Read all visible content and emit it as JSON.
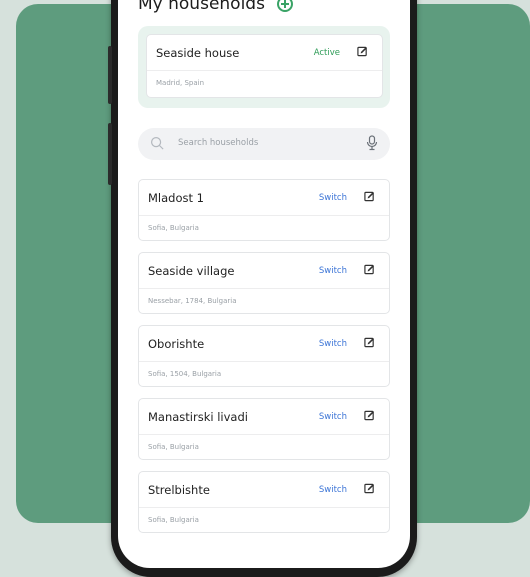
{
  "header": {
    "title": "My households"
  },
  "active_household": {
    "name": "Seaside house",
    "status": "Active",
    "address": "Madrid, Spain"
  },
  "search": {
    "placeholder": "Search households"
  },
  "households": [
    {
      "name": "Mladost 1",
      "address": "Sofia, Bulgaria",
      "action": "Switch"
    },
    {
      "name": "Seaside village",
      "address": "Nessebar, 1784, Bulgaria",
      "action": "Switch"
    },
    {
      "name": "Oborishte",
      "address": "Sofia, 1504, Bulgaria",
      "action": "Switch"
    },
    {
      "name": "Manastirski livadi",
      "address": "Sofia, Bulgaria",
      "action": "Switch"
    },
    {
      "name": "Strelbishte",
      "address": "Sofia, Bulgaria",
      "action": "Switch"
    }
  ],
  "colors": {
    "card_bg": "#5e9c7e",
    "page_bg": "#d6e1dc",
    "accent_green": "#2e9c57",
    "link_blue": "#3b74d6"
  }
}
